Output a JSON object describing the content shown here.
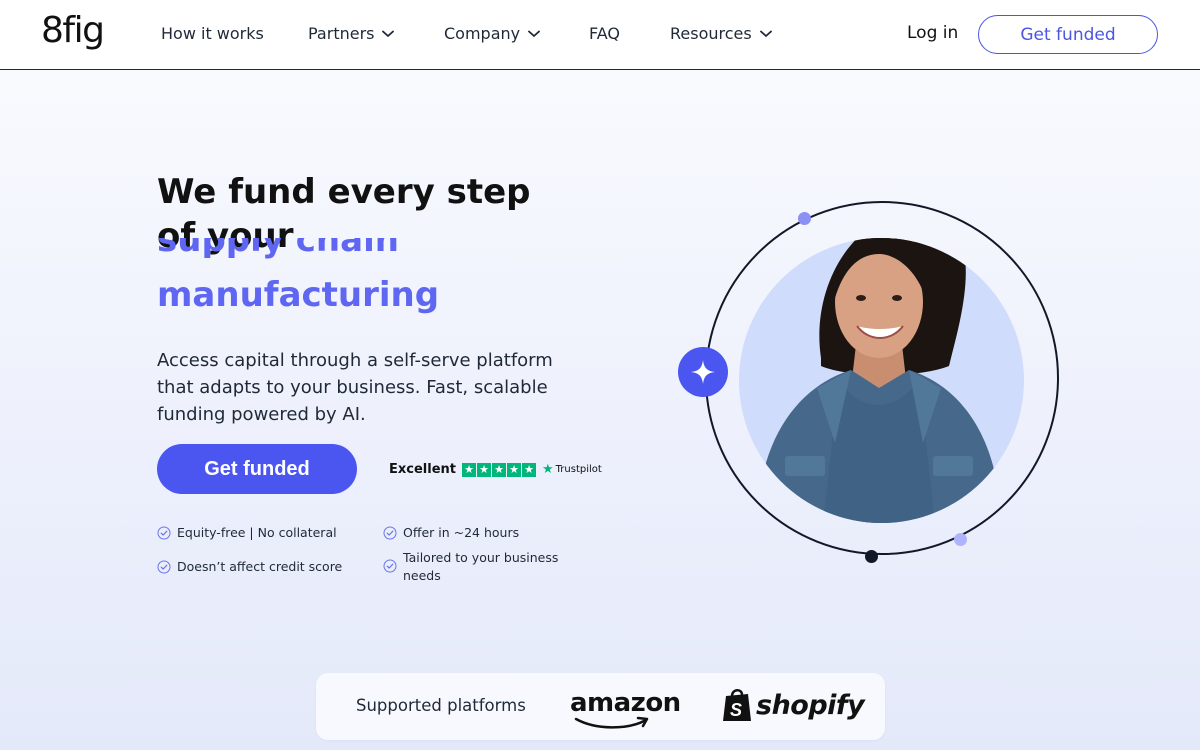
{
  "brand": {
    "logo_text": "8fig",
    "accent_color": "#4b55f0"
  },
  "nav": {
    "items": [
      {
        "label": "How it works",
        "has_dropdown": false
      },
      {
        "label": "Partners",
        "has_dropdown": true
      },
      {
        "label": "Company",
        "has_dropdown": true
      },
      {
        "label": "FAQ",
        "has_dropdown": false
      },
      {
        "label": "Resources",
        "has_dropdown": true
      }
    ],
    "login_label": "Log in",
    "cta_label": "Get funded"
  },
  "hero": {
    "title": "We fund every step of your",
    "rotating_prev": "supply chain",
    "rotating_word": "manufacturing",
    "subtitle": "Access capital through a self-serve platform that adapts to your business. Fast, scalable funding powered by AI.",
    "cta_label": "Get funded",
    "rating_label": "Excellent",
    "rating_stars": 5,
    "rating_source": "Trustpilot",
    "features": [
      "Equity-free | No collateral",
      "Offer in ~24 hours",
      "Doesn’t affect credit score",
      "Tailored to your business needs"
    ]
  },
  "illustration": {
    "icon": "sparkle-icon",
    "photo": "woman-portrait"
  },
  "platforms": {
    "label": "Supported platforms",
    "logos": [
      "amazon",
      "shopify"
    ]
  }
}
